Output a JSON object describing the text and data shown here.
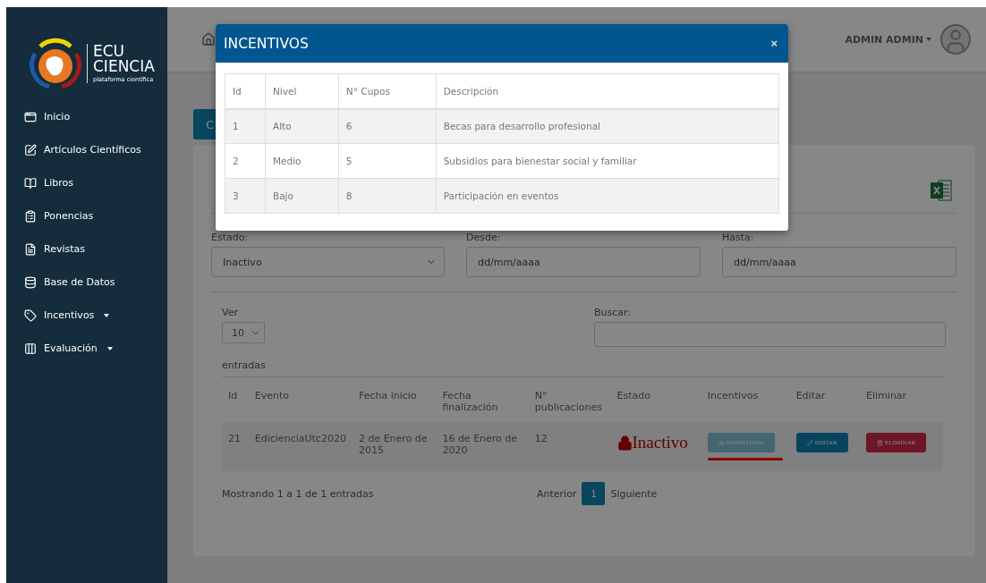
{
  "logo": {
    "line_1": "ECU",
    "line_2": "CIENCIA",
    "tagline": "plataforma científica"
  },
  "sidebar": {
    "items": [
      {
        "label": "Inicio",
        "has_menu": false
      },
      {
        "label": "Artículos Científicos",
        "has_menu": false
      },
      {
        "label": "Libros",
        "has_menu": false
      },
      {
        "label": "Ponencias",
        "has_menu": false
      },
      {
        "label": "Revistas",
        "has_menu": false
      },
      {
        "label": "Base de Datos",
        "has_menu": false
      },
      {
        "label": "Incentivos",
        "has_menu": true
      },
      {
        "label": "Evaluación",
        "has_menu": true
      }
    ]
  },
  "header": {
    "user": "ADMIN ADMIN"
  },
  "page": {
    "button_label": "C",
    "filters": [
      {
        "label": "Estado:",
        "kind": "select",
        "value": "Inactivo"
      },
      {
        "label": "Desde:",
        "kind": "date",
        "placeholder": "dd/mm/aaaa"
      },
      {
        "label": "Hasta:",
        "kind": "date",
        "placeholder": "dd/mm/aaaa"
      }
    ],
    "length": {
      "label": "Ver",
      "value": "10",
      "suffix": "entradas"
    },
    "search": {
      "label": "Buscar:"
    },
    "table": {
      "columns": [
        "Id",
        "Evento",
        "Fecha inicio",
        "Fecha finalización",
        "N° publicaciones",
        "Estado",
        "Incentivos",
        "Editar",
        "Eliminar"
      ],
      "rows": [
        {
          "id": "21",
          "evento": "EdicienciaUtc2020",
          "inicio": "2 de Enero de 2015",
          "fin": "16 de Enero de 2020",
          "publicaciones": "12",
          "estado": "Inactivo",
          "active": false,
          "incentivos": "INCENTIVOS",
          "editar": "EDITAR",
          "eliminar": "ELIMINAR"
        }
      ]
    },
    "info": "Mostrando 1 a 1 de 1 entradas",
    "pagination": {
      "previous": "Anterior",
      "pages": [
        {
          "label": "1",
          "selected": true
        }
      ],
      "next": "Siguiente"
    }
  },
  "modal": {
    "title": "INCENTIVOS",
    "close": "×",
    "columns": [
      "Id",
      "Nivel",
      "N° Cupos",
      "Descripción"
    ],
    "rows": [
      [
        "1",
        "Alto",
        "6",
        "Becas para desarrollo profesional"
      ],
      [
        "2",
        "Medio",
        "5",
        "Subsidios para bienestar social y familiar"
      ],
      [
        "3",
        "Bajo",
        "8",
        "Participación en eventos"
      ]
    ]
  }
}
